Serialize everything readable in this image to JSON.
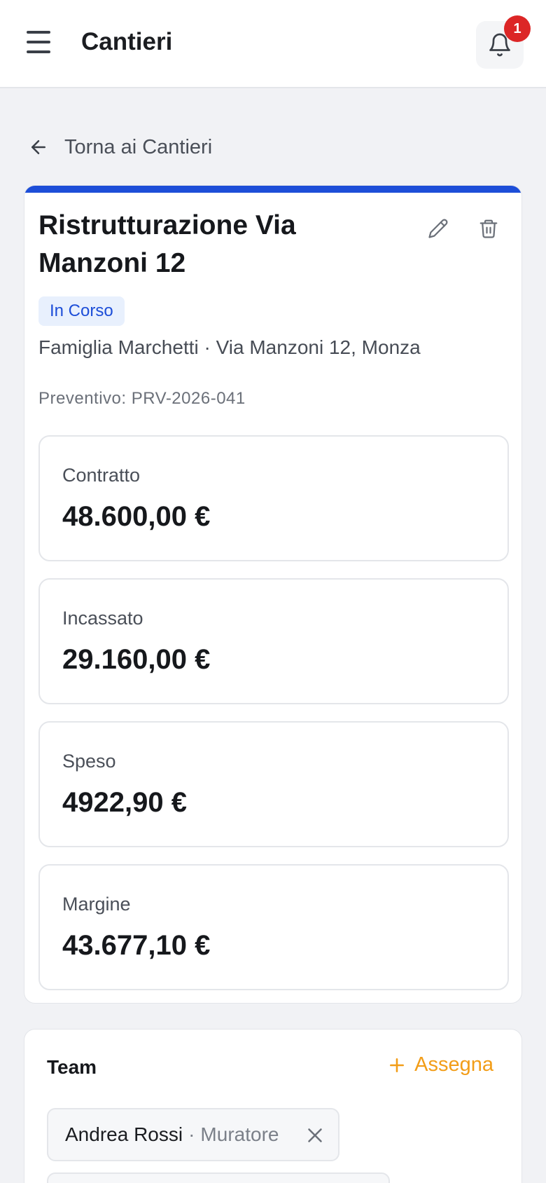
{
  "header": {
    "title": "Cantieri",
    "notification_count": "1"
  },
  "back": {
    "label": "Torna ai Cantieri"
  },
  "site": {
    "title": "Ristrutturazione Via Manzoni 12",
    "status": "In Corso",
    "client_address": "Famiglia Marchetti · Via Manzoni 12, Monza",
    "quote_ref": "Preventivo: PRV-2026-041",
    "accent_color": "#1d4ed8"
  },
  "stats": [
    {
      "label": "Contratto",
      "value": "48.600,00 €"
    },
    {
      "label": "Incassato",
      "value": "29.160,00 €"
    },
    {
      "label": "Speso",
      "value": "4922,90 €"
    },
    {
      "label": "Margine",
      "value": "43.677,10 €"
    }
  ],
  "team": {
    "title": "Team",
    "assign_label": "Assegna",
    "assign_color": "#f29d18",
    "members": [
      {
        "name": "Andrea Rossi",
        "separator": "·",
        "role": "Muratore"
      }
    ]
  },
  "icons": {
    "menu": "menu-icon",
    "bell": "bell-icon",
    "back": "arrow-left-icon",
    "edit": "pencil-icon",
    "delete": "trash-icon",
    "add": "plus-icon",
    "remove": "close-icon"
  }
}
